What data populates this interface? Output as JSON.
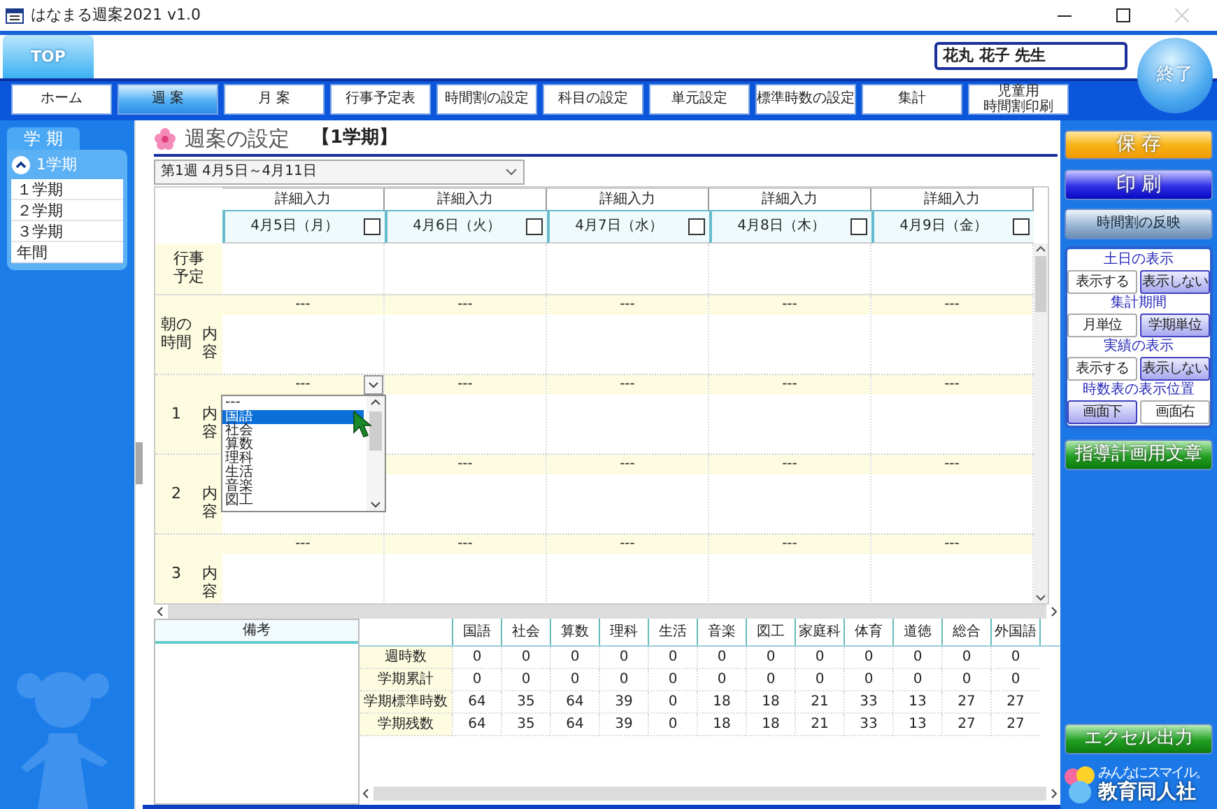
{
  "window": {
    "title": "はなまる週案2021 v1.0"
  },
  "top_tab": {
    "label": "TOP"
  },
  "teacher": "花丸 花子 先生",
  "exit_button": "終了",
  "nav": [
    {
      "label": "ホーム",
      "selected": false
    },
    {
      "label": "週 案",
      "selected": true
    },
    {
      "label": "月 案",
      "selected": false
    },
    {
      "label": "行事予定表",
      "selected": false
    },
    {
      "label": "時間割の設定",
      "selected": false
    },
    {
      "label": "科目の設定",
      "selected": false
    },
    {
      "label": "単元設定",
      "selected": false
    },
    {
      "label": "標準時数の設定",
      "selected": false
    },
    {
      "label": "集計",
      "selected": false
    },
    {
      "label": "児童用",
      "label_2": "時間割印刷",
      "selected": false
    }
  ],
  "term_panel": {
    "tab": "学 期",
    "current": "1学期",
    "expanded": true,
    "items": [
      "１学期",
      "２学期",
      "３学期",
      "年間"
    ]
  },
  "page": {
    "title": "週案の設定",
    "term": "【1学期】",
    "week": "第1週 4月5日～4月11日"
  },
  "days": [
    {
      "detail": "詳細入力",
      "date": "4月5日（月）",
      "checked": false
    },
    {
      "detail": "詳細入力",
      "date": "4月6日（火）",
      "checked": false
    },
    {
      "detail": "詳細入力",
      "date": "4月7日（水）",
      "checked": false
    },
    {
      "detail": "詳細入力",
      "date": "4月8日（木）",
      "checked": false
    },
    {
      "detail": "詳細入力",
      "date": "4月9日（金）",
      "checked": false
    }
  ],
  "schedule_label": "行事予定",
  "periods": [
    {
      "label": "朝の時間",
      "content_label": "内容",
      "cells": [
        {
          "subject": "---"
        },
        {
          "subject": "---"
        },
        {
          "subject": "---"
        },
        {
          "subject": "---"
        },
        {
          "subject": "---"
        }
      ]
    },
    {
      "label": "1",
      "content_label": "内容",
      "cells": [
        {
          "subject": "---",
          "open": true,
          "options": [
            {
              "label": "---",
              "selected": false
            },
            {
              "label": "国語",
              "selected": true
            },
            {
              "label": "社会",
              "selected": false
            },
            {
              "label": "算数",
              "selected": false
            },
            {
              "label": "理科",
              "selected": false
            },
            {
              "label": "生活",
              "selected": false
            },
            {
              "label": "音楽",
              "selected": false
            },
            {
              "label": "図工",
              "selected": false
            }
          ]
        },
        {
          "subject": "---"
        },
        {
          "subject": "---"
        },
        {
          "subject": "---"
        },
        {
          "subject": "---"
        }
      ]
    },
    {
      "label": "2",
      "content_label": "内容",
      "cells": [
        {},
        {
          "subject": "---"
        },
        {
          "subject": "---"
        },
        {
          "subject": "---"
        },
        {
          "subject": "---"
        }
      ]
    },
    {
      "label": "3",
      "content_label": "内容",
      "cells": [
        {
          "subject": "---"
        },
        {
          "subject": "---"
        },
        {
          "subject": "---"
        },
        {
          "subject": "---"
        },
        {
          "subject": "---"
        }
      ]
    }
  ],
  "notes_header": "備考",
  "stats": {
    "columns": [
      "国語",
      "社会",
      "算数",
      "理科",
      "生活",
      "音楽",
      "図工",
      "家庭科",
      "体育",
      "道徳",
      "総合",
      "外国語"
    ],
    "rows": [
      {
        "label": "週時数",
        "values": [
          "0",
          "0",
          "0",
          "0",
          "0",
          "0",
          "0",
          "0",
          "0",
          "0",
          "0",
          "0"
        ]
      },
      {
        "label": "学期累計",
        "values": [
          "0",
          "0",
          "0",
          "0",
          "0",
          "0",
          "0",
          "0",
          "0",
          "0",
          "0",
          "0"
        ]
      },
      {
        "label": "学期標準時数",
        "values": [
          "64",
          "35",
          "64",
          "39",
          "0",
          "18",
          "18",
          "21",
          "33",
          "13",
          "27",
          "27"
        ]
      },
      {
        "label": "学期残数",
        "values": [
          "64",
          "35",
          "64",
          "39",
          "0",
          "18",
          "18",
          "21",
          "33",
          "13",
          "27",
          "27"
        ]
      }
    ]
  },
  "actions": {
    "save": "保 存",
    "print": "印 刷",
    "reflect": "時間割の反映"
  },
  "options": [
    {
      "title": "土日の表示",
      "choices": [
        {
          "label": "表示する",
          "selected": false
        },
        {
          "label": "表示しない",
          "selected": true
        }
      ]
    },
    {
      "title": "集計期間",
      "choices": [
        {
          "label": "月単位",
          "selected": false
        },
        {
          "label": "学期単位",
          "selected": true
        }
      ]
    },
    {
      "title": "実績の表示",
      "choices": [
        {
          "label": "表示する",
          "selected": false
        },
        {
          "label": "表示しない",
          "selected": true
        }
      ]
    },
    {
      "title": "時数表の表示位置",
      "choices": [
        {
          "label": "画面下",
          "selected": true
        },
        {
          "label": "画面右",
          "selected": false
        }
      ]
    }
  ],
  "guidance_button": "指導計画用文章",
  "excel_button": "エクセル出力",
  "logo": {
    "tagline": "みんなにスマイル。",
    "name": "教育同人社"
  }
}
